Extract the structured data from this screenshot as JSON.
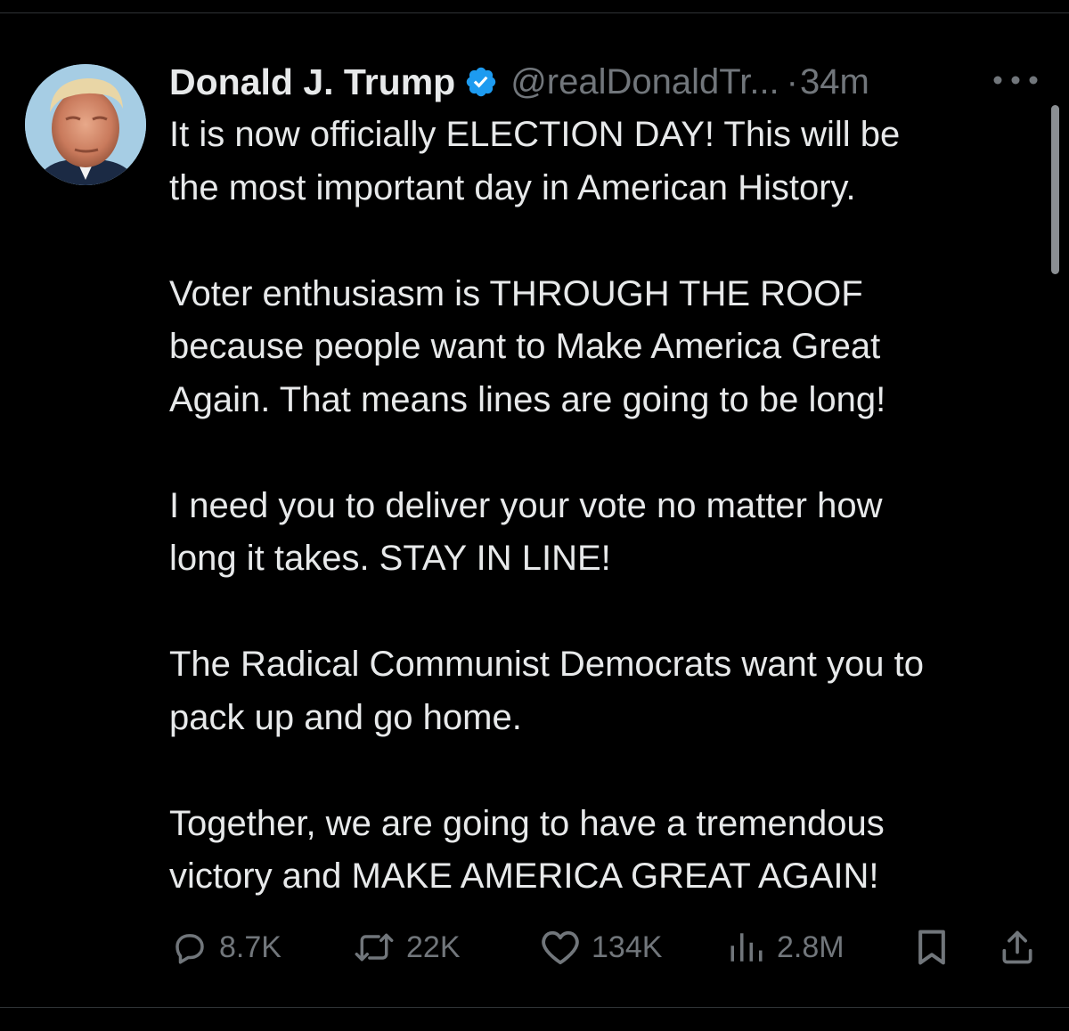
{
  "tweet": {
    "author": {
      "display_name": "Donald J. Trump",
      "handle": "@realDonaldTr...",
      "verified": true
    },
    "separator": "·",
    "time": "34m",
    "paragraphs": [
      "It is now officially ELECTION DAY! This will be\nthe most important day in American History.",
      "Voter enthusiasm is THROUGH THE ROOF\nbecause people want to Make America Great\nAgain. That means lines are going to be long!",
      "I need you to deliver your vote no matter how\nlong it takes. STAY IN LINE!",
      "The Radical Communist Democrats want you to\npack up and go home.",
      "Together, we are going to have a tremendous\nvictory and MAKE AMERICA GREAT AGAIN!"
    ],
    "actions": {
      "replies": "8.7K",
      "reposts": "22K",
      "likes": "134K",
      "views": "2.8M"
    }
  },
  "icons": {
    "verified": "verified-badge-icon",
    "more": "more-options-icon",
    "reply": "reply-icon",
    "repost": "repost-icon",
    "like": "heart-icon",
    "views": "analytics-icon",
    "bookmark": "bookmark-icon",
    "share": "share-icon"
  },
  "colors": {
    "background": "#000000",
    "text_primary": "#e7e9ea",
    "text_secondary": "#71767b",
    "verified_blue": "#1d9bf0",
    "divider": "#2f3336"
  }
}
